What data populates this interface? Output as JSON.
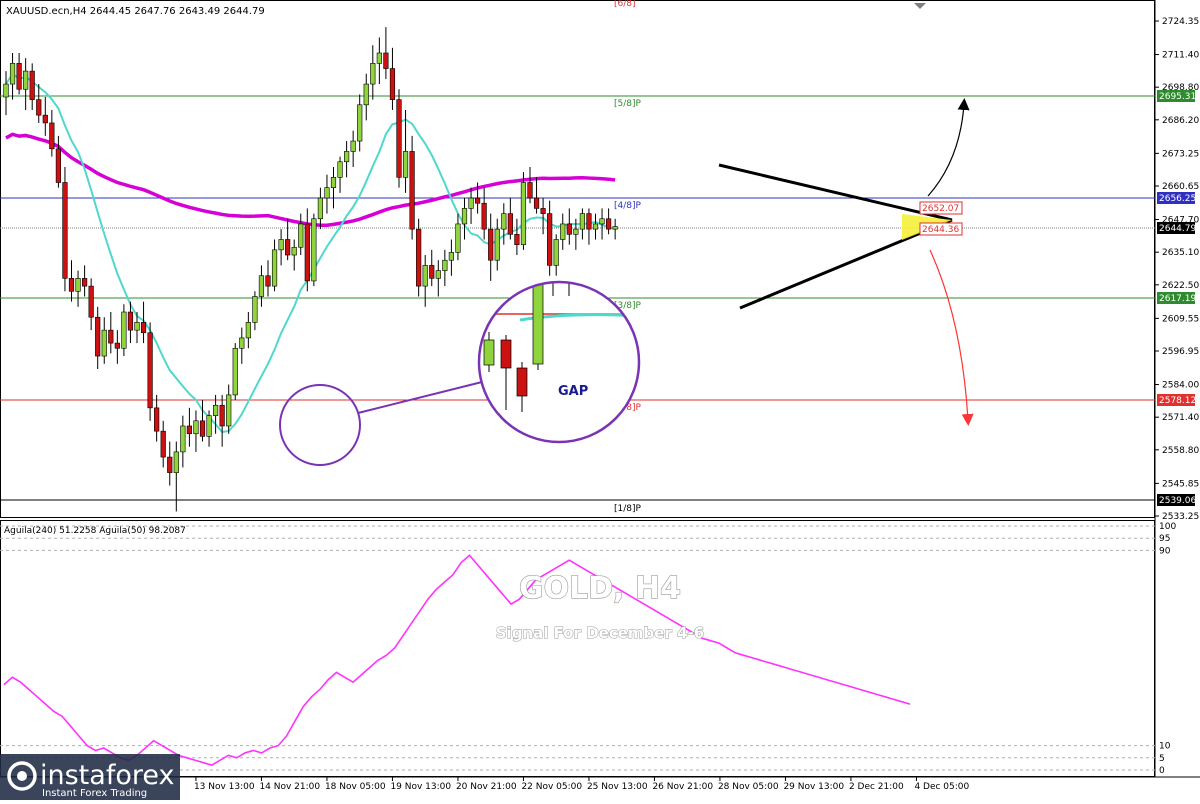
{
  "header": {
    "symbol_line": "XAUUSD.ecn,H4  2644.45 2647.76 2643.49 2644.79",
    "indicator_line": "Aguila(240) 51.2258  Aguila(50) 98.2087"
  },
  "watermark": {
    "title": "GOLD, H4",
    "subtitle": "Signal For December 4-6"
  },
  "annotation": {
    "gap_label": "GAP"
  },
  "logo": {
    "brand": "instaforex",
    "tagline": "Instant Forex Trading"
  },
  "colors": {
    "bull": "#8fd33d",
    "bear": "#cc1111",
    "ma_fast": "#4fd8cc",
    "ma_slow": "#d600d6",
    "murrey_green": "#2e8b2e",
    "murrey_red": "#e03030",
    "murrey_blue": "#3030c0",
    "oscillator": "#ff33ff",
    "circle": "#7a33b5",
    "triangle": "#000000",
    "arrow_up": "#000000",
    "arrow_down": "#ff3333"
  },
  "chart_data": [
    {
      "type": "candlestick",
      "title": "",
      "xlabel": "",
      "ylabel": "",
      "ylim": [
        2532,
        2729
      ],
      "y_ticks": [
        "2724.35",
        "2711.40",
        "2698.80",
        "2686.20",
        "2673.25",
        "2660.65",
        "2647.70",
        "2635.10",
        "2622.50",
        "2609.55",
        "2596.95",
        "2584.00",
        "2571.40",
        "2558.80",
        "2545.85",
        "2533.25"
      ],
      "x_ticks": [
        {
          "index": 29,
          "label": "13 Nov 13:00"
        },
        {
          "index": 39,
          "label": "14 Nov 21:00"
        },
        {
          "index": 49,
          "label": "18 Nov 05:00"
        },
        {
          "index": 59,
          "label": "19 Nov 13:00"
        },
        {
          "index": 69,
          "label": "20 Nov 21:00"
        },
        {
          "index": 79,
          "label": "22 Nov 05:00"
        },
        {
          "index": 89,
          "label": "25 Nov 13:00"
        },
        {
          "index": 99,
          "label": "26 Nov 21:00"
        },
        {
          "index": 109,
          "label": "28 Nov 05:00"
        },
        {
          "index": 119,
          "label": "29 Nov 13:00"
        },
        {
          "index": 129,
          "label": "2 Dec 21:00"
        },
        {
          "index": 139,
          "label": "4 Dec 05:00"
        }
      ],
      "ohlc": [
        [
          2695,
          2705,
          2688,
          2700
        ],
        [
          2700,
          2712,
          2694,
          2708
        ],
        [
          2708,
          2712,
          2696,
          2698
        ],
        [
          2698,
          2710,
          2690,
          2705
        ],
        [
          2705,
          2708,
          2690,
          2694
        ],
        [
          2694,
          2700,
          2685,
          2688
        ],
        [
          2688,
          2695,
          2680,
          2685
        ],
        [
          2685,
          2690,
          2672,
          2675
        ],
        [
          2675,
          2680,
          2660,
          2662
        ],
        [
          2662,
          2668,
          2620,
          2625
        ],
        [
          2625,
          2632,
          2616,
          2620
        ],
        [
          2620,
          2628,
          2614,
          2625
        ],
        [
          2625,
          2630,
          2618,
          2622
        ],
        [
          2622,
          2625,
          2605,
          2610
        ],
        [
          2610,
          2614,
          2590,
          2595
        ],
        [
          2595,
          2610,
          2592,
          2605
        ],
        [
          2605,
          2612,
          2596,
          2600
        ],
        [
          2600,
          2605,
          2592,
          2598
        ],
        [
          2598,
          2615,
          2595,
          2612
        ],
        [
          2612,
          2616,
          2600,
          2605
        ],
        [
          2605,
          2612,
          2600,
          2608
        ],
        [
          2608,
          2616,
          2600,
          2604
        ],
        [
          2604,
          2608,
          2570,
          2575
        ],
        [
          2575,
          2580,
          2562,
          2566
        ],
        [
          2566,
          2570,
          2552,
          2556
        ],
        [
          2556,
          2562,
          2545,
          2550
        ],
        [
          2550,
          2562,
          2535,
          2558
        ],
        [
          2558,
          2572,
          2552,
          2568
        ],
        [
          2568,
          2575,
          2560,
          2565
        ],
        [
          2565,
          2574,
          2558,
          2570
        ],
        [
          2570,
          2578,
          2562,
          2564
        ],
        [
          2564,
          2574,
          2560,
          2572
        ],
        [
          2572,
          2580,
          2565,
          2576
        ],
        [
          2576,
          2580,
          2560,
          2568
        ],
        [
          2568,
          2584,
          2565,
          2580
        ],
        [
          2580,
          2600,
          2578,
          2598
        ],
        [
          2598,
          2606,
          2592,
          2602
        ],
        [
          2602,
          2612,
          2598,
          2608
        ],
        [
          2608,
          2620,
          2605,
          2618
        ],
        [
          2618,
          2630,
          2614,
          2626
        ],
        [
          2626,
          2632,
          2618,
          2622
        ],
        [
          2622,
          2640,
          2620,
          2636
        ],
        [
          2636,
          2644,
          2630,
          2640
        ],
        [
          2640,
          2648,
          2632,
          2634
        ],
        [
          2634,
          2640,
          2628,
          2637
        ],
        [
          2637,
          2650,
          2634,
          2646
        ],
        [
          2646,
          2652,
          2620,
          2624
        ],
        [
          2624,
          2650,
          2622,
          2648
        ],
        [
          2648,
          2660,
          2644,
          2656
        ],
        [
          2656,
          2665,
          2650,
          2660
        ],
        [
          2660,
          2668,
          2652,
          2664
        ],
        [
          2664,
          2672,
          2658,
          2670
        ],
        [
          2670,
          2678,
          2664,
          2674
        ],
        [
          2674,
          2682,
          2668,
          2678
        ],
        [
          2678,
          2696,
          2674,
          2692
        ],
        [
          2692,
          2704,
          2686,
          2700
        ],
        [
          2700,
          2715,
          2694,
          2708
        ],
        [
          2708,
          2718,
          2700,
          2712
        ],
        [
          2712,
          2722,
          2702,
          2706
        ],
        [
          2706,
          2714,
          2690,
          2694
        ],
        [
          2694,
          2698,
          2660,
          2664
        ],
        [
          2664,
          2690,
          2658,
          2674
        ],
        [
          2674,
          2680,
          2640,
          2644
        ],
        [
          2644,
          2648,
          2618,
          2622
        ],
        [
          2622,
          2634,
          2614,
          2630
        ],
        [
          2630,
          2636,
          2622,
          2625
        ],
        [
          2625,
          2632,
          2618,
          2628
        ],
        [
          2628,
          2636,
          2622,
          2632
        ],
        [
          2632,
          2640,
          2626,
          2635
        ],
        [
          2635,
          2650,
          2632,
          2646
        ],
        [
          2646,
          2656,
          2640,
          2652
        ],
        [
          2652,
          2660,
          2646,
          2656
        ],
        [
          2656,
          2662,
          2650,
          2654
        ],
        [
          2654,
          2660,
          2640,
          2644
        ],
        [
          2644,
          2650,
          2624,
          2632
        ],
        [
          2632,
          2648,
          2628,
          2644
        ],
        [
          2644,
          2654,
          2638,
          2650
        ],
        [
          2650,
          2656,
          2640,
          2642
        ],
        [
          2642,
          2648,
          2634,
          2638
        ],
        [
          2638,
          2666,
          2636,
          2662
        ],
        [
          2662,
          2668,
          2654,
          2656
        ],
        [
          2656,
          2664,
          2650,
          2652
        ],
        [
          2652,
          2656,
          2642,
          2650
        ],
        [
          2650,
          2655,
          2626,
          2630
        ],
        [
          2630,
          2642,
          2626,
          2640
        ],
        [
          2640,
          2650,
          2636,
          2646
        ],
        [
          2646,
          2652,
          2638,
          2642
        ],
        [
          2642,
          2648,
          2636,
          2644
        ],
        [
          2644,
          2652,
          2640,
          2650
        ],
        [
          2650,
          2652,
          2638,
          2644
        ],
        [
          2644,
          2650,
          2640,
          2646
        ],
        [
          2646,
          2652,
          2640,
          2648
        ],
        [
          2648,
          2652,
          2642,
          2644
        ],
        [
          2644,
          2648,
          2640,
          2645
        ]
      ]
    },
    {
      "type": "line",
      "title": "",
      "xlabel": "",
      "ylabel": "",
      "ylim": [
        0,
        100
      ],
      "y_ticks": [
        "100",
        "95",
        "90",
        "10",
        "5",
        "0"
      ],
      "series": [
        {
          "values": [
            35,
            38,
            36,
            33,
            30,
            27,
            24,
            22,
            18,
            14,
            10,
            8,
            9,
            7,
            5,
            4,
            6,
            9,
            12,
            10,
            8,
            6,
            5,
            4,
            3,
            2,
            4,
            6,
            5,
            7,
            8,
            7,
            9,
            10,
            14,
            20,
            26,
            30,
            33,
            37,
            40,
            38,
            36,
            39,
            42,
            45,
            47,
            50,
            55,
            60,
            65,
            70,
            74,
            77,
            80,
            85,
            88,
            84,
            80,
            76,
            72,
            68,
            70,
            74,
            78,
            80,
            82,
            84,
            86,
            84,
            82,
            80,
            78,
            76,
            74,
            72,
            70,
            68,
            66,
            64,
            62,
            60,
            58,
            56,
            54,
            53,
            52,
            50,
            48,
            47,
            46,
            45,
            44,
            43,
            42,
            41,
            40,
            39,
            38,
            37,
            36,
            35,
            34,
            33,
            32,
            31,
            30,
            29,
            28,
            27
          ]
        }
      ]
    }
  ],
  "price_tags": {
    "p2695": "2695.31",
    "p2656": "2656.25",
    "p2644": "2644.79",
    "p2617": "2617.19",
    "p2578": "2578.12",
    "p2539": "2539.06",
    "box_top": "2652.07",
    "box_bottom": "2644.36"
  },
  "murrey_labels": {
    "m68": "[6/8]",
    "m58": "[5/8]P",
    "m48": "[4/8]P",
    "m38": "[3/8]P",
    "m28": "[2/8]P",
    "m18": "[1/8]P"
  }
}
